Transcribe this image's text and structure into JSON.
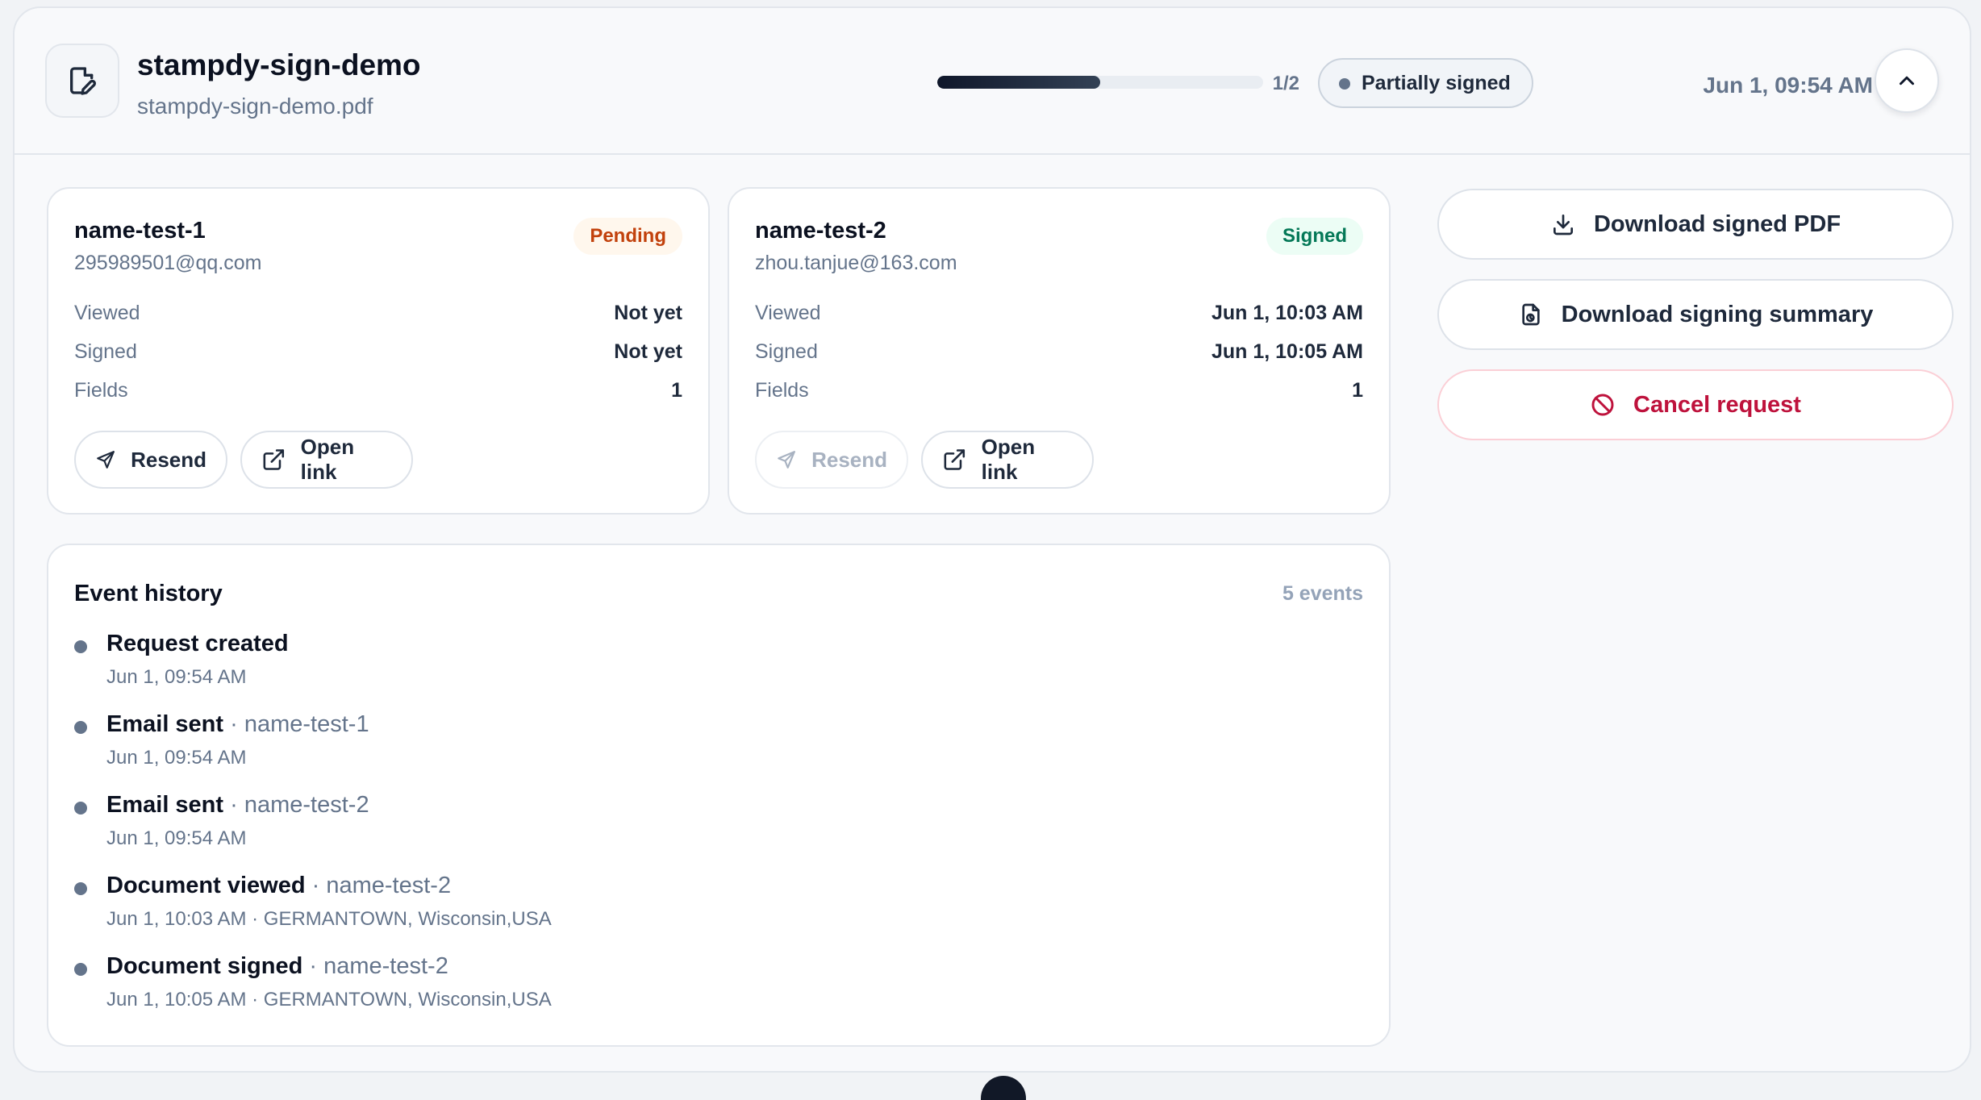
{
  "header": {
    "title": "stampdy-sign-demo",
    "filename": "stampdy-sign-demo.pdf",
    "progress_text": "1/2",
    "progress_fraction": 0.5,
    "status": "Partially signed",
    "date": "Jun 1, 09:54 AM"
  },
  "signers": [
    {
      "name": "name-test-1",
      "email": "295989501@qq.com",
      "status": "Pending",
      "rows": [
        {
          "label": "Viewed",
          "value": "Not yet"
        },
        {
          "label": "Signed",
          "value": "Not yet"
        },
        {
          "label": "Fields",
          "value": "1"
        }
      ],
      "resend_label": "Resend",
      "open_label": "Open link"
    },
    {
      "name": "name-test-2",
      "email": "zhou.tanjue@163.com",
      "status": "Signed",
      "rows": [
        {
          "label": "Viewed",
          "value": "Jun 1, 10:03 AM"
        },
        {
          "label": "Signed",
          "value": "Jun 1, 10:05 AM"
        },
        {
          "label": "Fields",
          "value": "1"
        }
      ],
      "resend_label": "Resend",
      "open_label": "Open link"
    }
  ],
  "actions": {
    "download_pdf": "Download signed PDF",
    "download_summary": "Download signing summary",
    "cancel": "Cancel request"
  },
  "events": {
    "title": "Event history",
    "count": "5 events",
    "items": [
      {
        "title": "Request created",
        "sep": "",
        "who": "",
        "meta": "Jun 1, 09:54 AM"
      },
      {
        "title": "Email sent",
        "sep": " · ",
        "who": "name-test-1",
        "meta": "Jun 1, 09:54 AM"
      },
      {
        "title": "Email sent",
        "sep": " · ",
        "who": "name-test-2",
        "meta": "Jun 1, 09:54 AM"
      },
      {
        "title": "Document viewed",
        "sep": " · ",
        "who": "name-test-2",
        "meta": "Jun 1, 10:03 AM · GERMANTOWN, Wisconsin,USA"
      },
      {
        "title": "Document signed",
        "sep": " · ",
        "who": "name-test-2",
        "meta": "Jun 1, 10:05 AM · GERMANTOWN, Wisconsin,USA"
      }
    ]
  },
  "colors": {
    "pending": "#c2410c",
    "signed": "#047857",
    "danger": "#be123c",
    "muted": "#64748b"
  },
  "icons": {
    "document": "file-signature-icon",
    "collapse": "chevron-up-icon",
    "resend": "send-icon",
    "open_link": "external-link-icon",
    "download": "download-icon",
    "summary": "file-summary-icon",
    "cancel": "ban-icon"
  }
}
